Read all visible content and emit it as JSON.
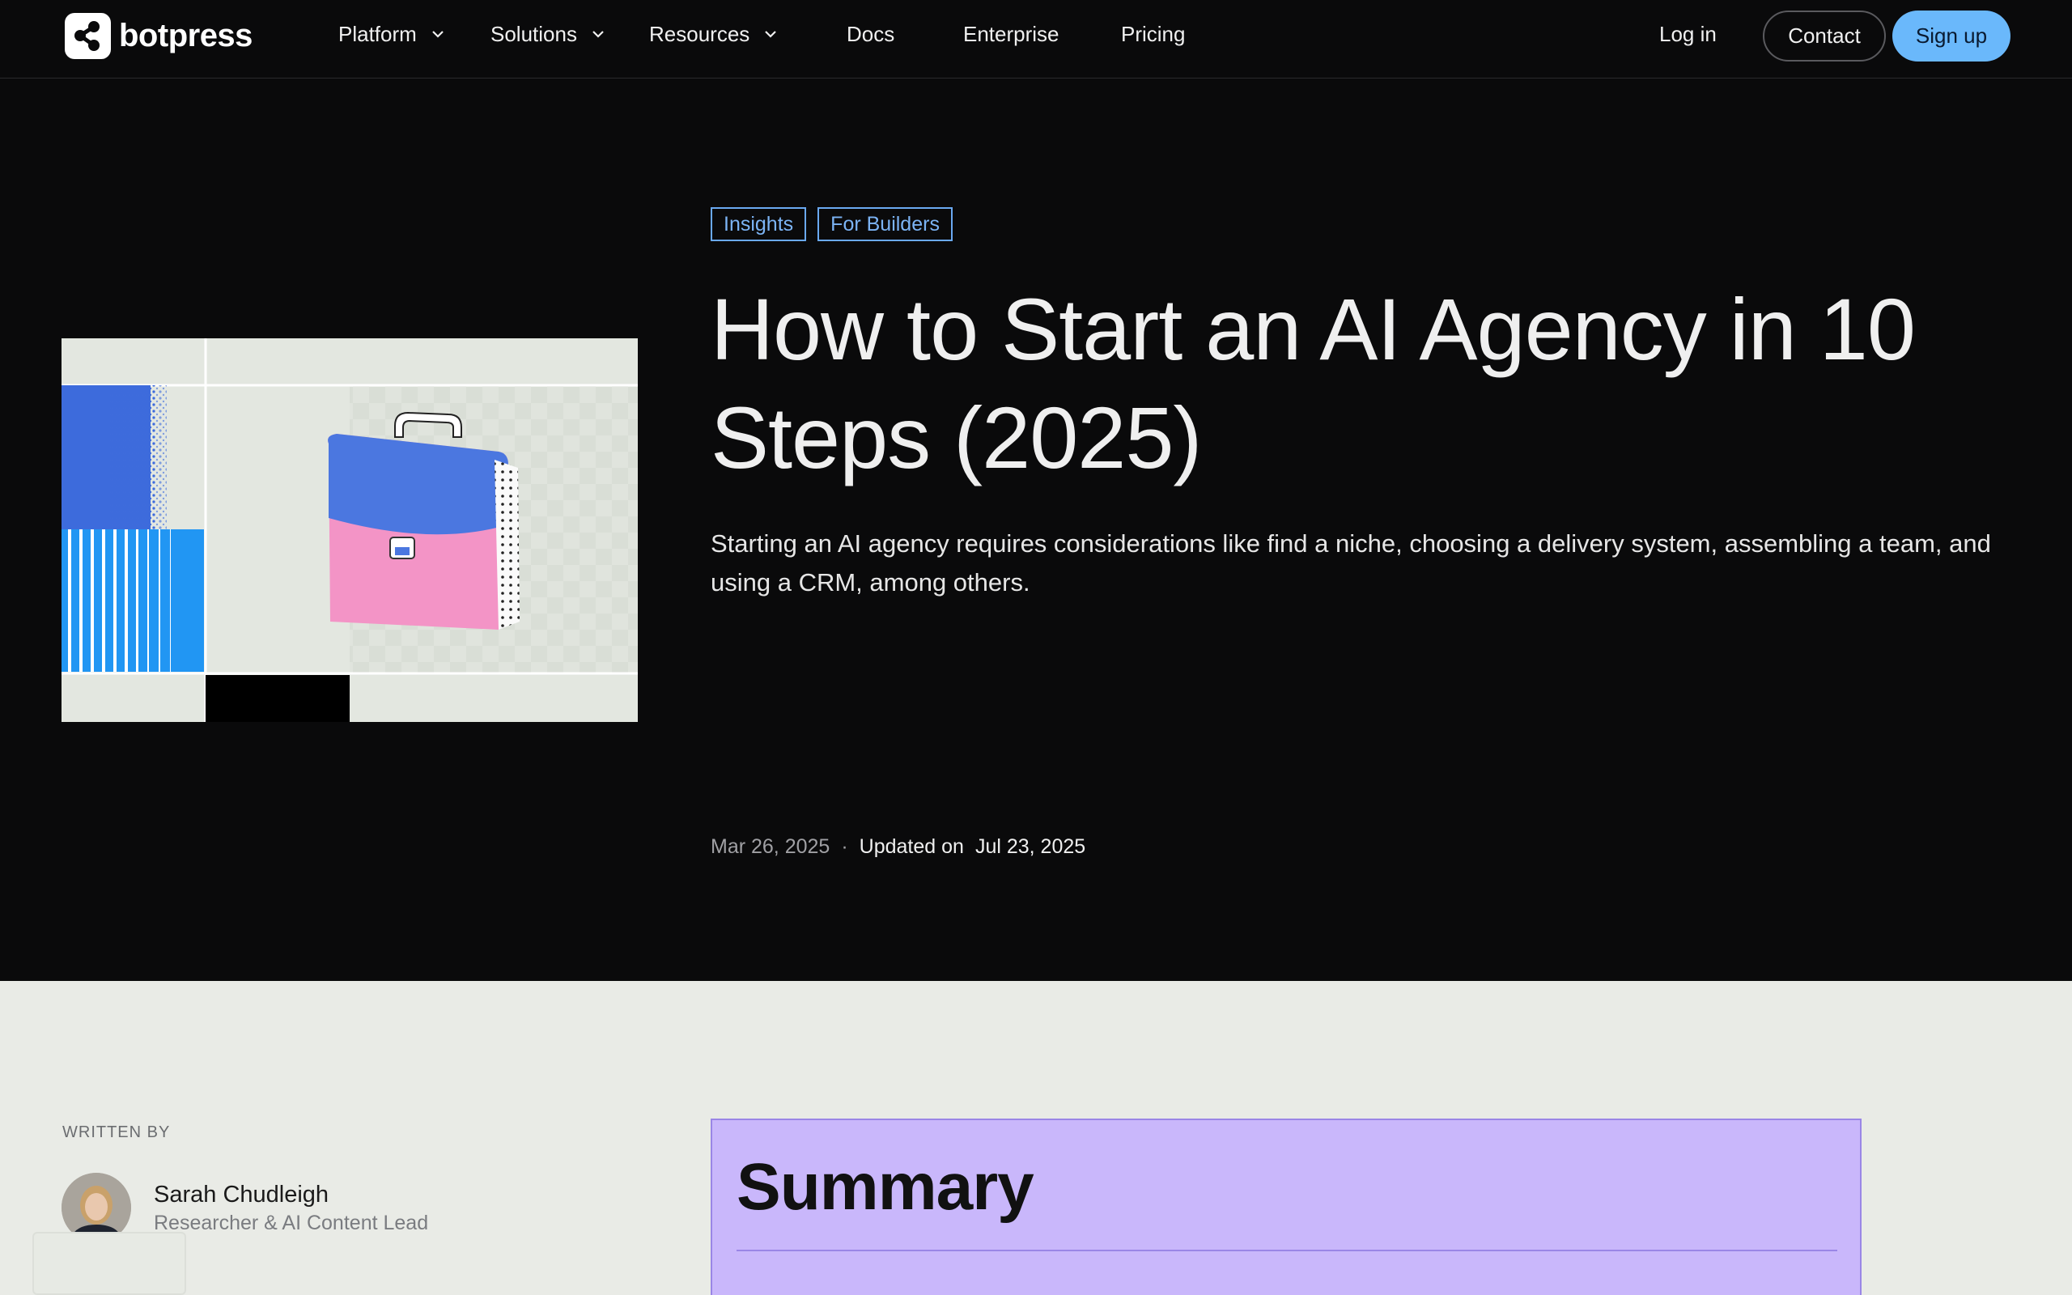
{
  "nav": {
    "brand": "botpress",
    "items": [
      {
        "label": "Platform",
        "dropdown": true
      },
      {
        "label": "Solutions",
        "dropdown": true
      },
      {
        "label": "Resources",
        "dropdown": true
      },
      {
        "label": "Docs",
        "dropdown": false
      },
      {
        "label": "Enterprise",
        "dropdown": false
      },
      {
        "label": "Pricing",
        "dropdown": false
      }
    ],
    "login": "Log in",
    "contact": "Contact",
    "signup": "Sign up"
  },
  "hero": {
    "tags": [
      "Insights",
      "For Builders"
    ],
    "title": "How to Start an AI Agency in 10 Steps (2025)",
    "subtitle": "Starting an AI agency requires considerations like find a niche, choosing a delivery system, assembling a team, and using a CRM, among others.",
    "published": "Mar 26, 2025",
    "separator": "·",
    "updated_label": "Updated on",
    "updated": "Jul 23, 2025"
  },
  "author": {
    "section_label": "WRITTEN BY",
    "name": "Sarah Chudleigh",
    "role": "Researcher & AI Content Lead"
  },
  "summary": {
    "title": "Summary"
  },
  "colors": {
    "accent_blue": "#6ab8fb",
    "tag_blue": "#7cb4f5",
    "summary_bg": "#c9b7fb",
    "page_dark": "#0a0a0b",
    "page_light": "#e9ebe6"
  }
}
